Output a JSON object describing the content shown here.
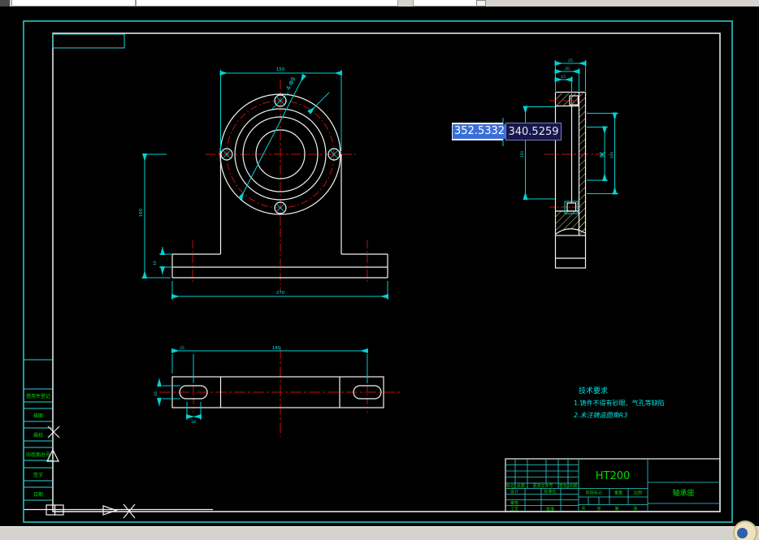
{
  "app": {
    "kind": "cad-drawing-editor",
    "colors": {
      "canvas_bg": "#000000",
      "geometry": "#f2f2f2",
      "dimension_cyan": "#00d2d2",
      "centerline_red": "#c01010",
      "hatch_yellow": "#dcdc82",
      "titleblock_green": "#00dd00",
      "selection_blue": "#3a6fd8",
      "tooltip_navy": "#161650"
    }
  },
  "dynamic_input": {
    "x_value": "352.5332",
    "y_value": "340.5259"
  },
  "tech_requirements": {
    "title": "技术要求",
    "line1": "1.铸件不得有砂眼、气孔等缺陷",
    "line2": "2.未注铸造圆角R3"
  },
  "title_block": {
    "material": "HT200",
    "part_name": "轴承座",
    "header": {
      "mark": "标记",
      "count": "处数",
      "file": "更改文件号",
      "sign": "签名",
      "date": "日期"
    },
    "rows": {
      "design": "设计",
      "standard": "标准化",
      "check": "审核",
      "process": "工艺",
      "approve": "批准"
    },
    "stage": "阶段标记",
    "weight": "重量",
    "scale": "比例",
    "sheet": {
      "total": "共",
      "zhang1": "张",
      "page": "第",
      "zhang2": "张"
    }
  },
  "left_strip": {
    "items": [
      "借用件登记",
      "描图",
      "描校",
      "旧底图总号",
      "签字",
      "日期"
    ]
  },
  "dimensions": {
    "front_width": "150",
    "front_bolt_callout": "4-Φ9",
    "front_height": "160",
    "base_thickness": "16",
    "base_width": "270",
    "plan_length": "140",
    "plan_offset": "25",
    "plan_slot_width": "16",
    "plan_slot_len": "18",
    "side_top1": "25",
    "side_top2": "20",
    "side_top3": "15",
    "side_left": "150",
    "side_right_inner": "80",
    "side_right_outer": "100"
  }
}
